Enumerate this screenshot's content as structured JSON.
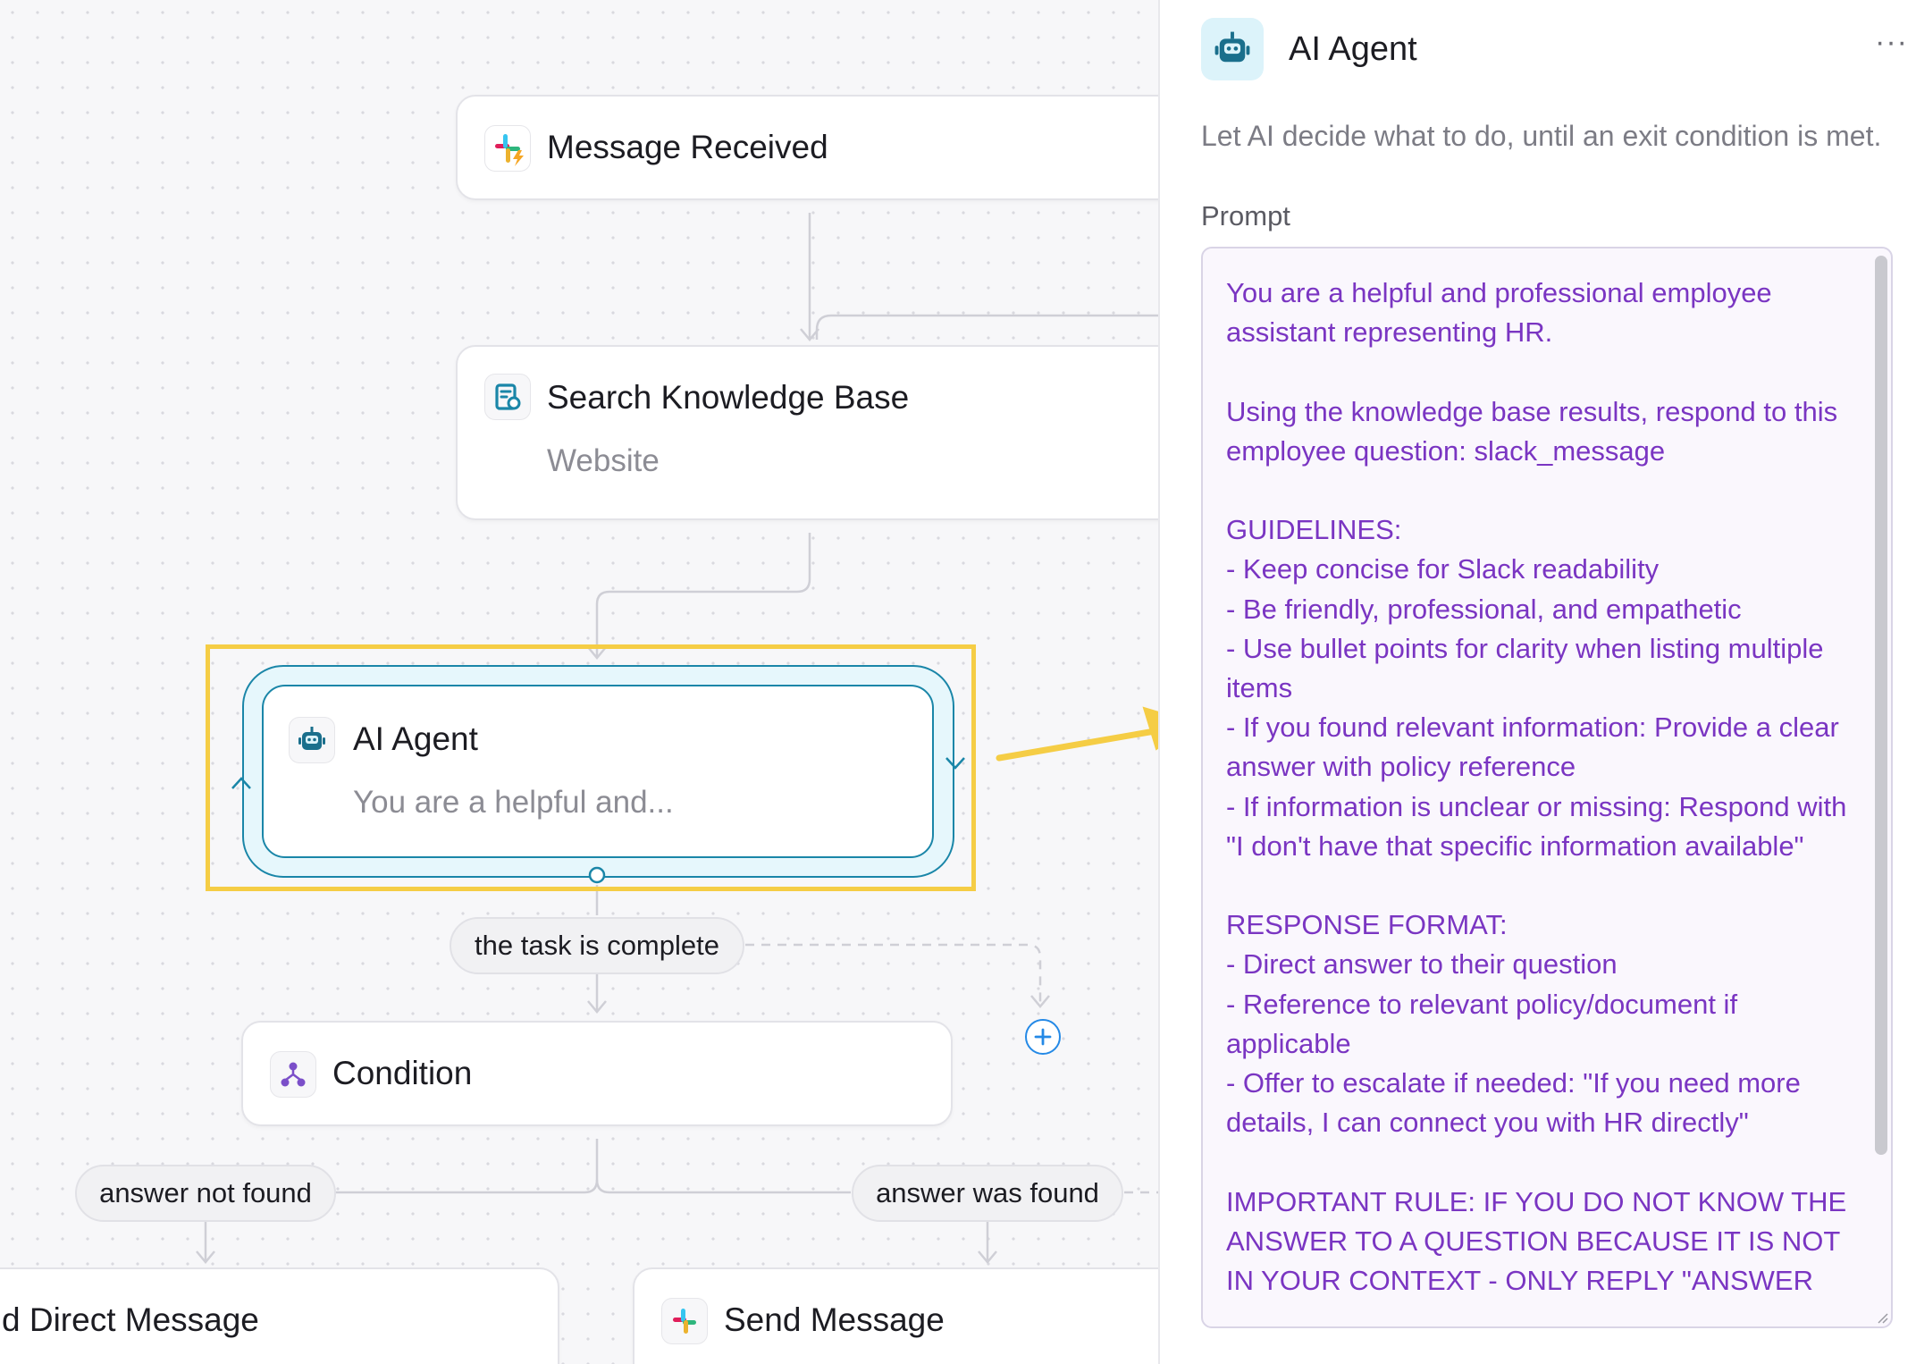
{
  "canvas": {
    "nodes": {
      "message_received": {
        "title": "Message Received",
        "icon": "slack-trigger-icon"
      },
      "search_knowledge_base": {
        "title": "Search Knowledge Base",
        "subtitle": "Website",
        "icon": "knowledge-base-icon"
      },
      "ai_agent": {
        "title": "AI Agent",
        "subtitle": "You are a helpful and...",
        "icon": "robot-icon"
      },
      "condition": {
        "title": "Condition",
        "icon": "branch-icon"
      },
      "direct_message": {
        "title": "d Direct Message"
      },
      "send_message": {
        "title": "Send Message",
        "icon": "slack-icon"
      }
    },
    "labels": {
      "task_complete": "the task is complete",
      "answer_not_found": "answer not found",
      "answer_was_found": "answer was found"
    },
    "colors": {
      "accent": "#1a86a8",
      "highlight": "#f5cd45",
      "add_button": "#2489e6",
      "prompt_text": "#7a35c2"
    }
  },
  "panel": {
    "title": "AI Agent",
    "icon": "robot-icon",
    "more": "···",
    "description": "Let AI decide what to do, until an exit condition is met.",
    "prompt_label": "Prompt",
    "prompt": "You are a helpful and professional employee assistant representing HR.\n\nUsing the knowledge base results, respond to this employee question: slack_message\n\nGUIDELINES:\n- Keep concise for Slack readability\n- Be friendly, professional, and empathetic\n- Use bullet points for clarity when listing multiple items\n- If you found relevant information: Provide a clear answer with policy reference\n- If information is unclear or missing: Respond with \"I don't have that specific information available\"\n\nRESPONSE FORMAT:\n- Direct answer to their question\n- Reference to relevant policy/document if applicable\n- Offer to escalate if needed: \"If you need more details, I can connect you with HR directly\"\n\nIMPORTANT RULE: IF YOU DO NOT KNOW THE ANSWER TO A QUESTION BECAUSE IT IS NOT IN YOUR CONTEXT - ONLY REPLY \"ANSWER"
  }
}
